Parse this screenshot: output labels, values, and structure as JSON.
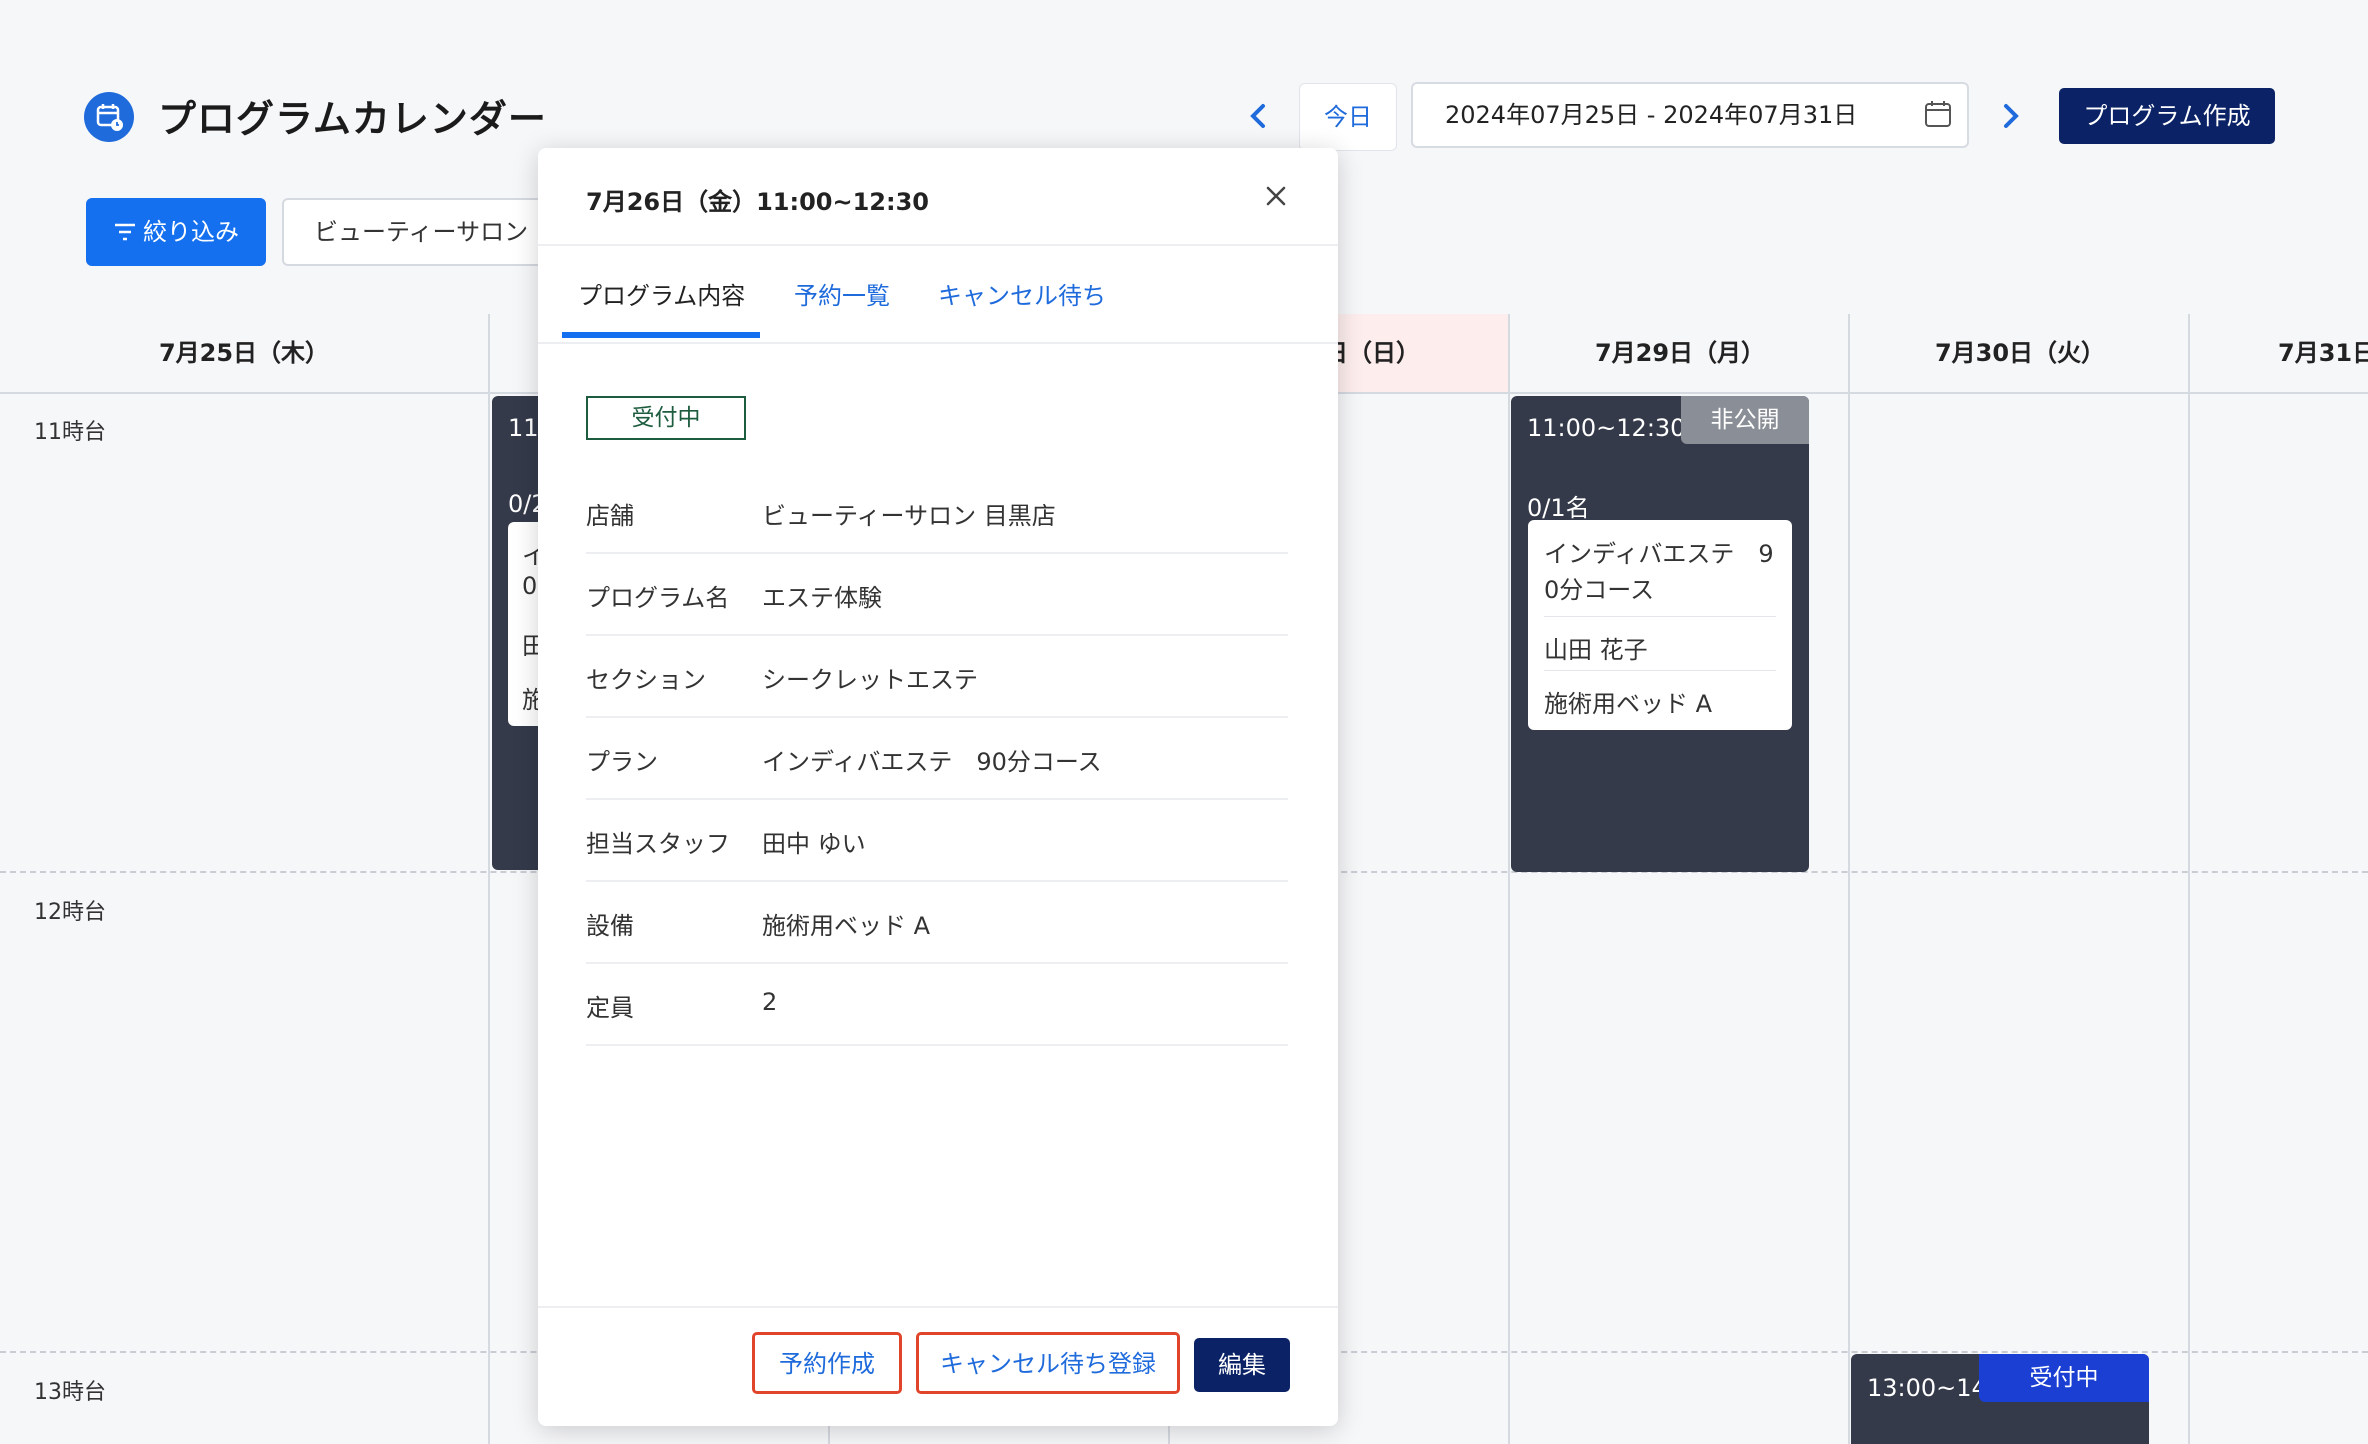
{
  "header": {
    "title": "プログラムカレンダー",
    "today_label": "今日",
    "date_range": "2024年07月25日 - 2024年07月31日",
    "create_label": "プログラム作成",
    "filter_label": "絞り込み",
    "store_filter": "ビューティーサロン"
  },
  "calendar": {
    "days": [
      "7月25日（木）",
      "日（日）",
      "7月29日（月）",
      "7月30日（火）",
      "7月31日"
    ],
    "time_labels": [
      "11時台",
      "12時台",
      "13時台"
    ],
    "left_event": {
      "time_fragment": "11:",
      "count_fragment": "0/2",
      "lines": [
        "イ",
        "0",
        "田",
        "施"
      ]
    },
    "event_29": {
      "time": "11:00~12:30",
      "badge": "非公開",
      "count": "0/1名",
      "plan_line1": "インディバエステ　9",
      "plan_line2": "0分コース",
      "customer": "山田 花子",
      "equipment": "施術用ベッド A"
    },
    "event_30": {
      "time": "13:00~14:30",
      "badge": "受付中"
    }
  },
  "modal": {
    "title": "7月26日（金）11:00~12:30",
    "tabs": [
      "プログラム内容",
      "予約一覧",
      "キャンセル待ち"
    ],
    "status": "受付中",
    "rows": [
      {
        "label": "店舗",
        "value": "ビューティーサロン 目黒店"
      },
      {
        "label": "プログラム名",
        "value": "エステ体験"
      },
      {
        "label": "セクション",
        "value": "シークレットエステ"
      },
      {
        "label": "プラン",
        "value": "インディバエステ　90分コース"
      },
      {
        "label": "担当スタッフ",
        "value": "田中 ゆい"
      },
      {
        "label": "設備",
        "value": "施術用ベッド A"
      },
      {
        "label": "定員",
        "value": "2"
      }
    ],
    "buttons": {
      "reserve": "予約作成",
      "waitlist": "キャンセル待ち登録",
      "edit": "編集"
    }
  },
  "colors": {
    "primary": "#1570ef",
    "navy": "#0b2366",
    "event_bg": "#343a4a",
    "sunday_bg": "#fdeeed",
    "highlight_red": "#e0452b",
    "status_green": "#1d5c3f"
  }
}
